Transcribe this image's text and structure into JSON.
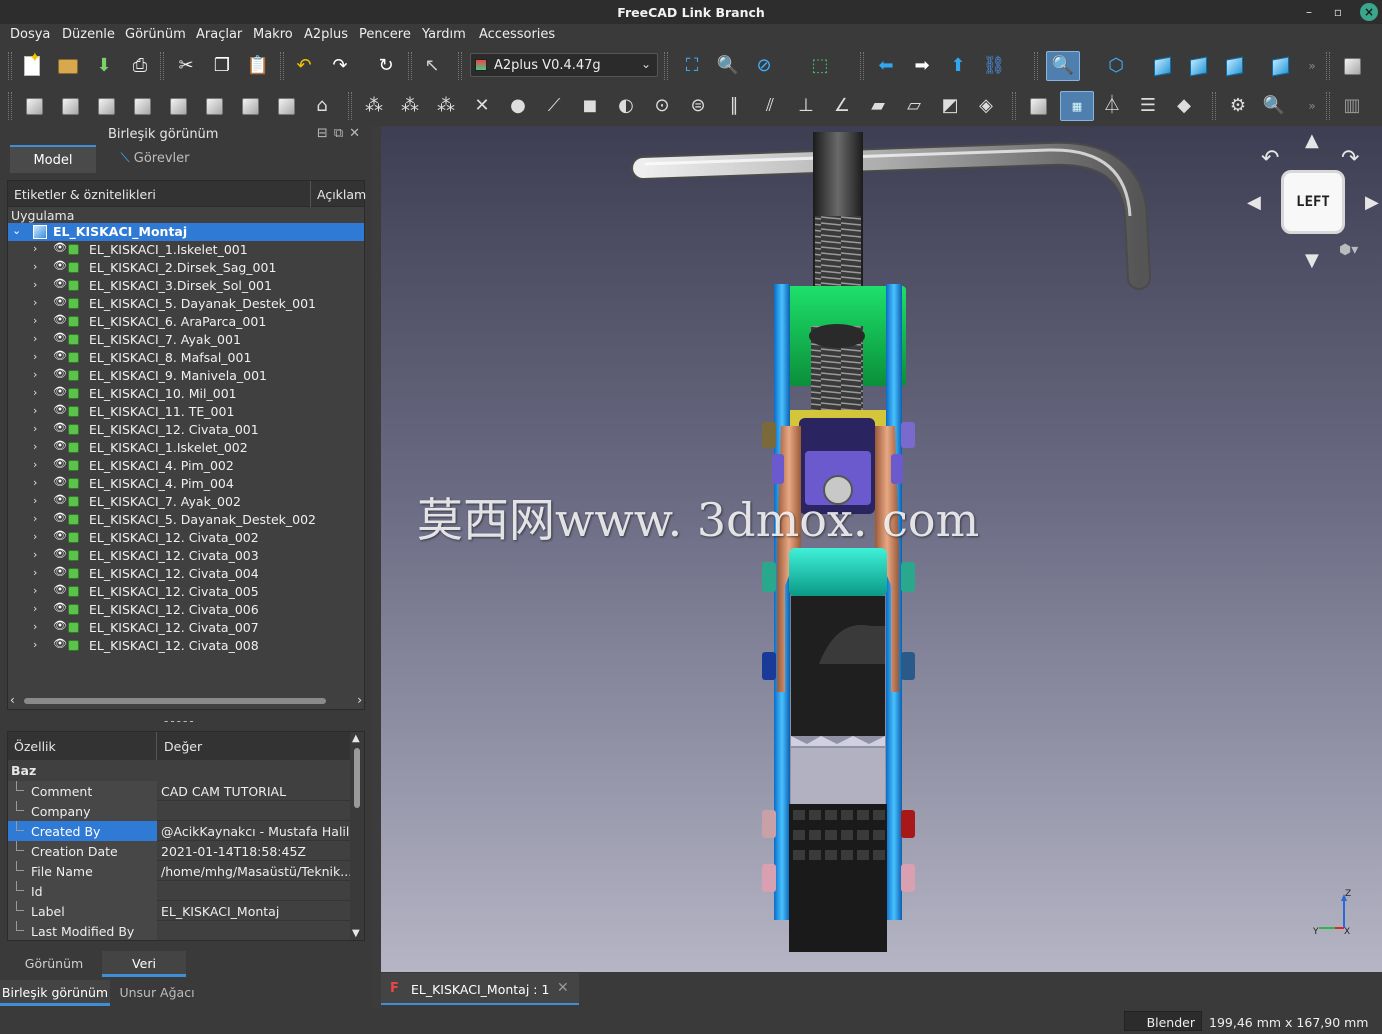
{
  "window": {
    "title": "FreeCAD Link Branch"
  },
  "menu": [
    "Dosya",
    "Düzenle",
    "Görünüm",
    "Araçlar",
    "Makro",
    "A2plus",
    "Pencere",
    "Yardım",
    "Accessories"
  ],
  "toolbar": {
    "workbench": "A2plus V0.4.47g"
  },
  "combo_view": {
    "title": "Birleşik görünüm",
    "tabs": {
      "model": "Model",
      "tasks": "Görevler"
    },
    "tree": {
      "col_labels": "Etiketler & öznitelikleri",
      "col_desc": "Açıklam",
      "app_label": "Uygulama",
      "root": "EL_KISKACI_Montaj",
      "items": [
        "EL_KISKACI_1.Iskelet_001",
        "EL_KISKACI_2.Dirsek_Sag_001",
        "EL_KISKACI_3.Dirsek_Sol_001",
        "EL_KISKACI_5. Dayanak_Destek_001",
        "EL_KISKACI_6. AraParca_001",
        "EL_KISKACI_7. Ayak_001",
        "EL_KISKACI_8. Mafsal_001",
        "EL_KISKACI_9. Manivela_001",
        "EL_KISKACI_10. Mil_001",
        "EL_KISKACI_11. TE_001",
        "EL_KISKACI_12. Civata_001",
        "EL_KISKACI_1.Iskelet_002",
        "EL_KISKACI_4. Pim_002",
        "EL_KISKACI_4. Pim_004",
        "EL_KISKACI_7. Ayak_002",
        "EL_KISKACI_5. Dayanak_Destek_002",
        "EL_KISKACI_12. Civata_002",
        "EL_KISKACI_12. Civata_003",
        "EL_KISKACI_12. Civata_004",
        "EL_KISKACI_12. Civata_005",
        "EL_KISKACI_12. Civata_006",
        "EL_KISKACI_12. Civata_007",
        "EL_KISKACI_12. Civata_008"
      ]
    },
    "splitter": "-----",
    "properties": {
      "col_property": "Özellik",
      "col_value": "Değer",
      "group": "Baz",
      "rows": [
        {
          "key": "Comment",
          "value": "CAD CAM TUTORIAL"
        },
        {
          "key": "Company",
          "value": ""
        },
        {
          "key": "Created By",
          "value": "@AcikKaynakcı - Mustafa Halil"
        },
        {
          "key": "Creation Date",
          "value": "2021-01-14T18:58:45Z"
        },
        {
          "key": "File Name",
          "value": "/home/mhg/Masaüstü/Teknik..."
        },
        {
          "key": "Id",
          "value": ""
        },
        {
          "key": "Label",
          "value": "EL_KISKACI_Montaj"
        },
        {
          "key": "Last Modified By",
          "value": ""
        }
      ]
    },
    "prop_tabs": {
      "view": "Görünüm",
      "data": "Veri"
    },
    "bottom_tabs": {
      "combo": "Birleşik görünüm",
      "tree": "Unsur Ağacı"
    }
  },
  "viewport": {
    "watermark": "莫西网www. 3dmox. com",
    "navcube_face": "LEFT",
    "axis_labels": {
      "z": "Z",
      "y": "Y",
      "x": "X"
    }
  },
  "document_tab": "EL_KISKACI_Montaj : 1",
  "status": {
    "navigation": "Blender",
    "dimensions": "199,46 mm x 167,90 mm"
  }
}
